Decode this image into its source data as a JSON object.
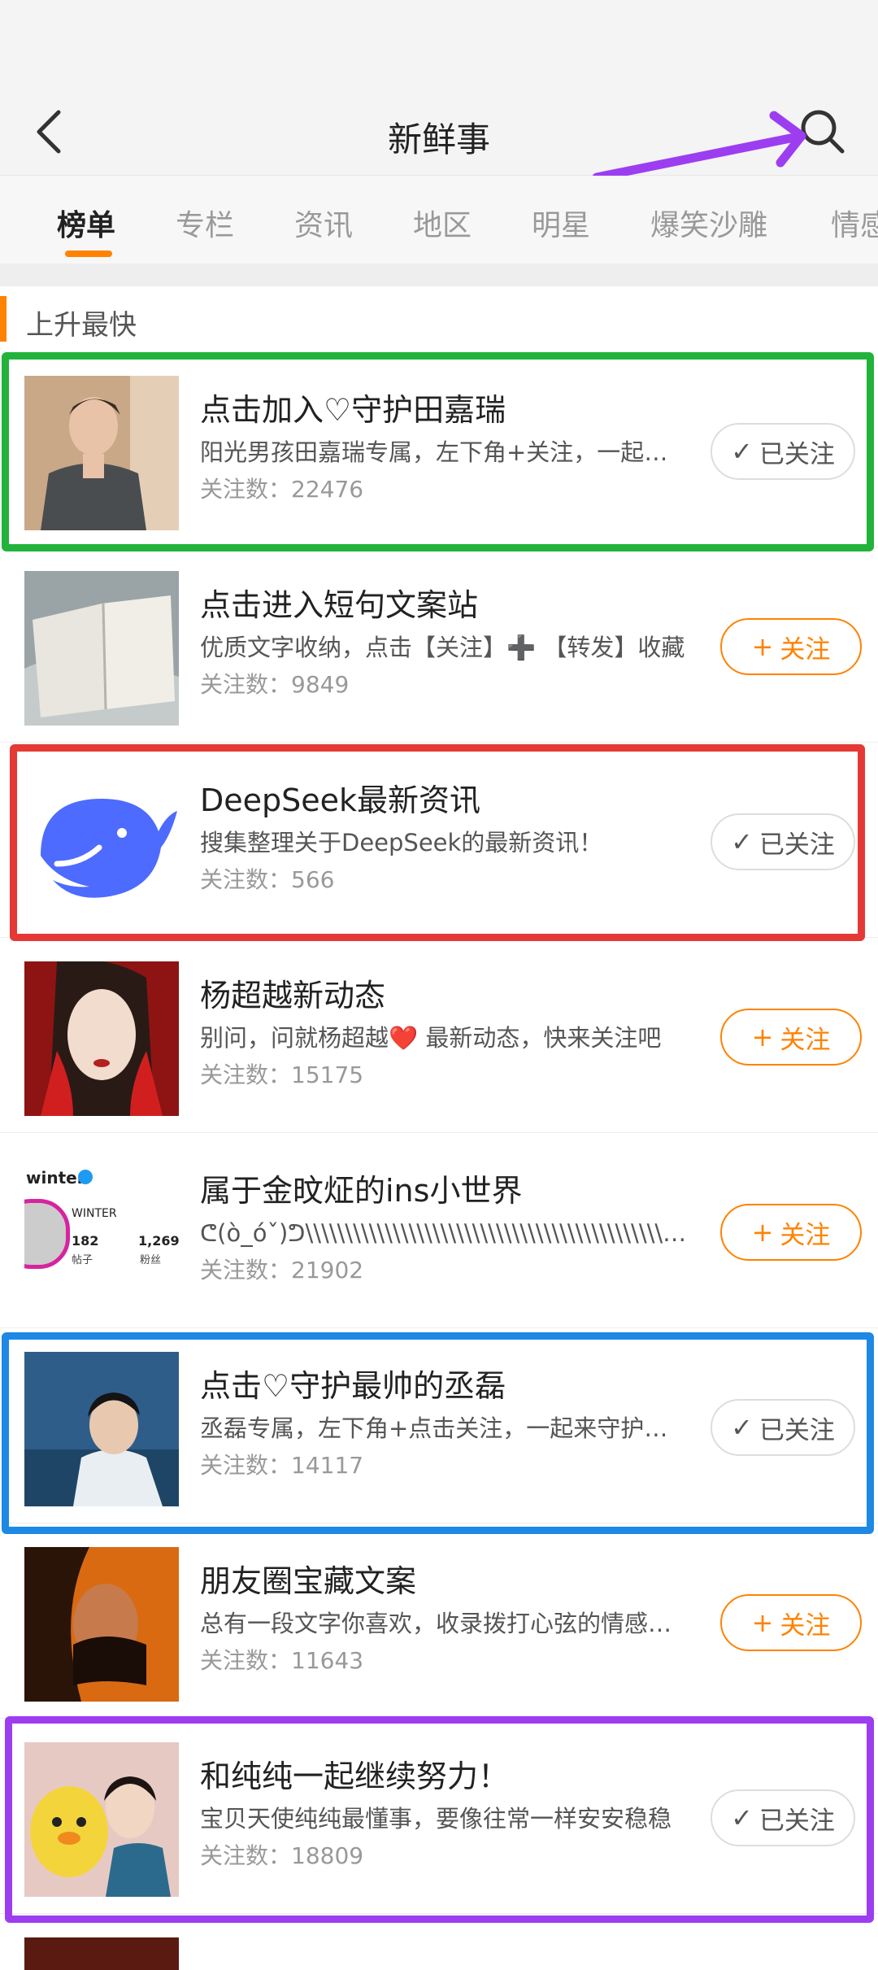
{
  "header": {
    "title": "新鲜事",
    "back_icon": "chevron-left-icon",
    "search_icon": "search-icon"
  },
  "tabs": [
    {
      "label": "榜单",
      "active": true
    },
    {
      "label": "专栏"
    },
    {
      "label": "资讯"
    },
    {
      "label": "地区"
    },
    {
      "label": "明星"
    },
    {
      "label": "爆笑沙雕"
    },
    {
      "label": "情感"
    }
  ],
  "section": {
    "title": "上升最快"
  },
  "colors": {
    "accent": "#ff8200",
    "highlight_green": "#22b33a",
    "highlight_red": "#e53935",
    "highlight_blue": "#1e88e5",
    "highlight_purple": "#9c3ef0"
  },
  "items": [
    {
      "name": "点击加入♡守护田嘉瑞",
      "desc": "阳光男孩田嘉瑞专属，左下角+关注，一起来守护",
      "count": "关注数：22476",
      "button": "已关注",
      "state": "followed"
    },
    {
      "name": "点击进入短句文案站",
      "desc": "优质文字收纳，点击【关注】➕ 【转发】收藏",
      "count": "关注数：9849",
      "button": "关注",
      "state": "follow"
    },
    {
      "name": "DeepSeek最新资讯",
      "desc": "搜集整理关于DeepSeek的最新资讯！",
      "count": "关注数：566",
      "button": "已关注",
      "state": "followed"
    },
    {
      "name": "杨超越新动态",
      "desc": "别问，问就杨超越❤️ 最新动态，快来关注吧",
      "count": "关注数：15175",
      "button": "关注",
      "state": "follow"
    },
    {
      "name": "属于金旼炡的ins小世界",
      "desc": "ᕦ(ò_óˇ)ᕤ\\\\\\\\\\\\\\\\\\\\\\\\\\\\\\\\\\\\\\\\\\\\\\\\\\\\\\\\\\\\\\\\\\\\\\\\\\\\\\\\\\\\\\\\\\\\\\\\\\\\\\\\\\\\\\\\\\\\\\\\\\\\\\\\\\",
      "count": "关注数：21902",
      "button": "关注",
      "state": "follow",
      "thumb_text": {
        "handle": "winter",
        "name": "WINTER",
        "posts": "182",
        "posts_label": "帖子",
        "fans": "1,269",
        "fans_label": "粉丝"
      }
    },
    {
      "name": "点击♡守护最帅的丞磊",
      "desc": "丞磊专属，左下角+点击关注，一起来守护丞磊",
      "count": "关注数：14117",
      "button": "已关注",
      "state": "followed"
    },
    {
      "name": "朋友圈宝藏文案",
      "desc": "总有一段文字你喜欢，收录拨打心弦的情感文案",
      "count": "关注数：11643",
      "button": "关注",
      "state": "follow"
    },
    {
      "name": "和纯纯一起继续努力！",
      "desc": "宝贝天使纯纯最懂事，要像往常一样安安稳稳",
      "count": "关注数：18809",
      "button": "已关注",
      "state": "followed"
    }
  ]
}
